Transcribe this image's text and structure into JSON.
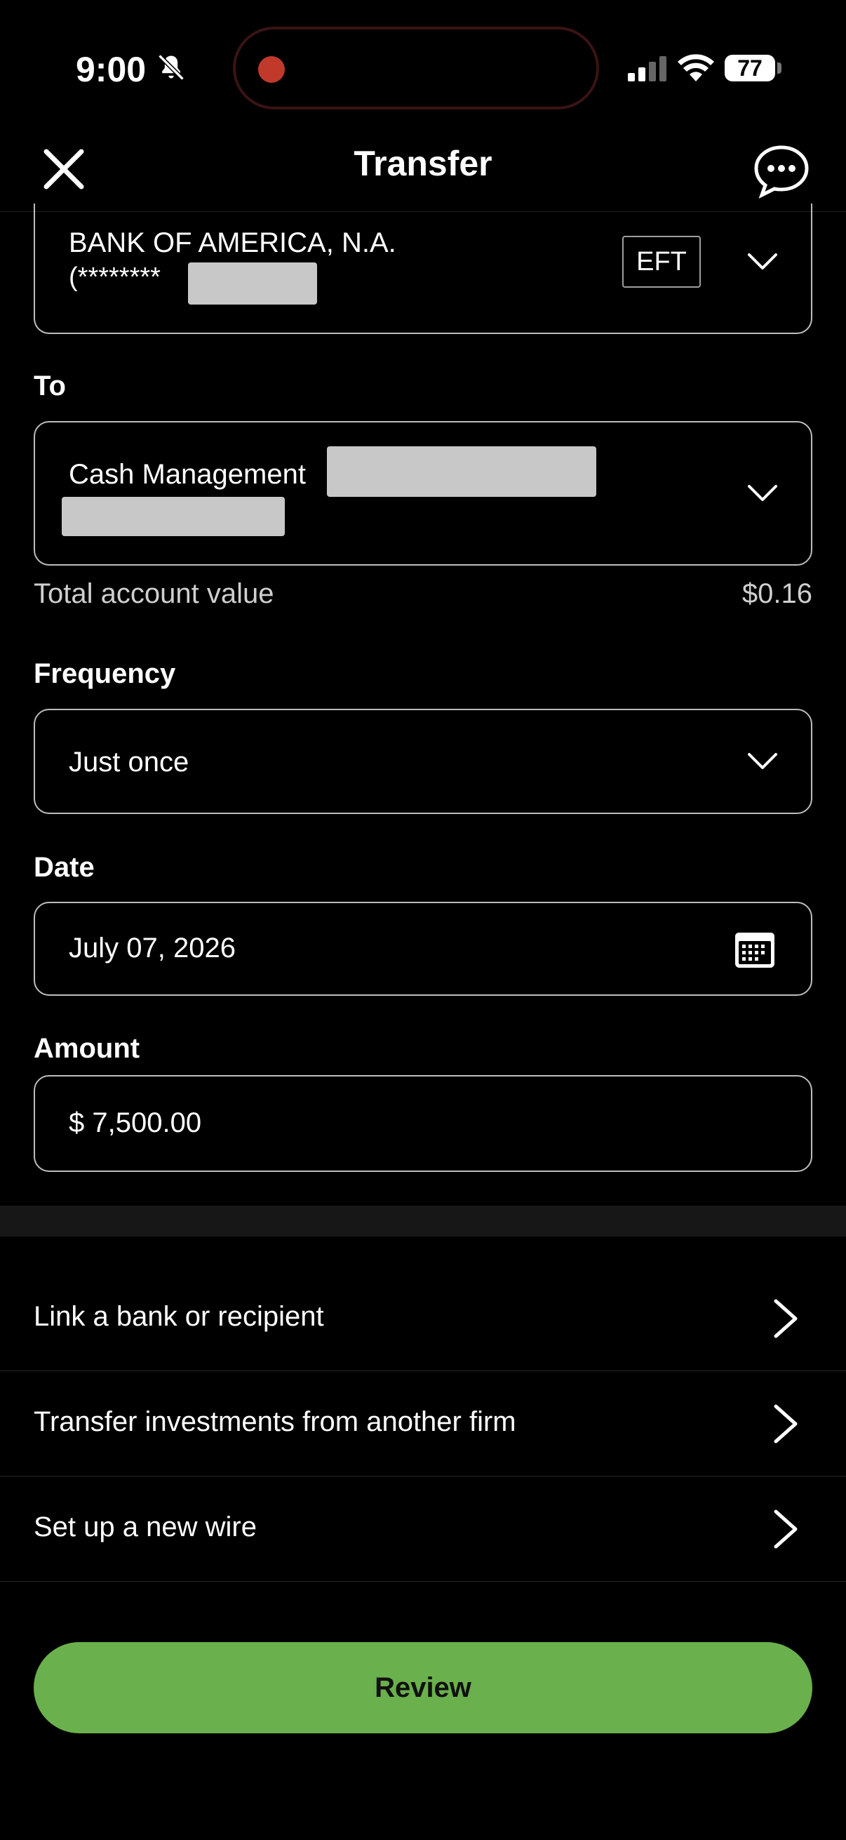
{
  "status_bar": {
    "time": "9:00",
    "battery": "77",
    "icons": [
      "bell-slash-icon",
      "signal-icon",
      "wifi-icon",
      "battery-icon"
    ]
  },
  "header": {
    "title": "Transfer",
    "icons": [
      "close-icon",
      "chat-bubble-icon"
    ]
  },
  "from": {
    "bank_name": "BANK OF AMERICA, N.A.",
    "account_mask": "(********",
    "method_badge": "EFT"
  },
  "to": {
    "label": "To",
    "account_name": "Cash Management",
    "total_label": "Total account value",
    "total_value": "$0.16"
  },
  "frequency": {
    "label": "Frequency",
    "value": "Just once"
  },
  "date": {
    "label": "Date",
    "value": "July 07, 2026",
    "icon": "calendar-icon"
  },
  "amount": {
    "label": "Amount",
    "value": "$ 7,500.00"
  },
  "links": [
    {
      "label": "Link a bank or recipient"
    },
    {
      "label": "Transfer investments from another firm"
    },
    {
      "label": "Set up a new wire"
    }
  ],
  "review_label": "Review",
  "colors": {
    "background": "#000000",
    "accent_green": "#6ab04c",
    "field_border": "#bdbdbd"
  }
}
